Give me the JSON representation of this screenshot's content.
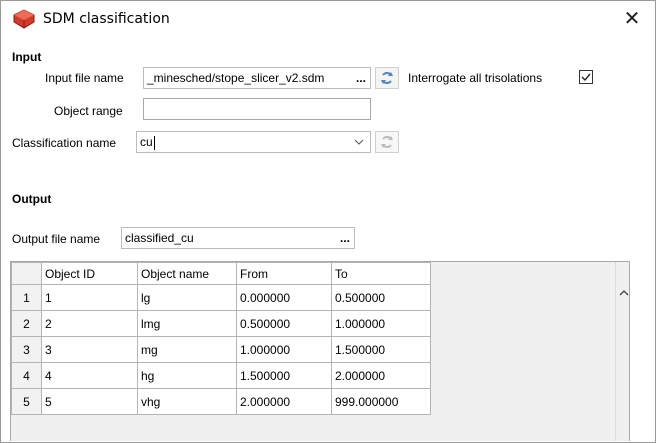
{
  "window": {
    "title": "SDM classification",
    "close_glyph": "✕",
    "app_icon": "sdm-app-icon"
  },
  "input_section": {
    "heading": "Input",
    "input_file_label": "Input file name",
    "input_file_value": "_minesched/stope_slicer_v2.sdm",
    "browse_glyph": "...",
    "interrogate_label": "Interrogate all trisolations",
    "interrogate_checked": true,
    "object_range_label": "Object range",
    "object_range_value": "",
    "classification_label": "Classification name",
    "classification_value": "cu"
  },
  "output_section": {
    "heading": "Output",
    "output_file_label": "Output file name",
    "output_file_value": "classified_cu",
    "browse_glyph": "..."
  },
  "table": {
    "columns": [
      "Object ID",
      "Object name",
      "From",
      "To"
    ],
    "rows": [
      {
        "n": "1",
        "id": "1",
        "name": "lg",
        "from": "0.000000",
        "to": "0.500000"
      },
      {
        "n": "2",
        "id": "2",
        "name": "lmg",
        "from": "0.500000",
        "to": "1.000000"
      },
      {
        "n": "3",
        "id": "3",
        "name": "mg",
        "from": "1.000000",
        "to": "1.500000"
      },
      {
        "n": "4",
        "id": "4",
        "name": "hg",
        "from": "1.500000",
        "to": "2.000000"
      },
      {
        "n": "5",
        "id": "5",
        "name": "vhg",
        "from": "2.000000",
        "to": "999.000000"
      }
    ]
  },
  "colors": {
    "icon_red": "#d23a2a",
    "spin_blue": "#4a86c8",
    "border": "#bcbcbc"
  }
}
